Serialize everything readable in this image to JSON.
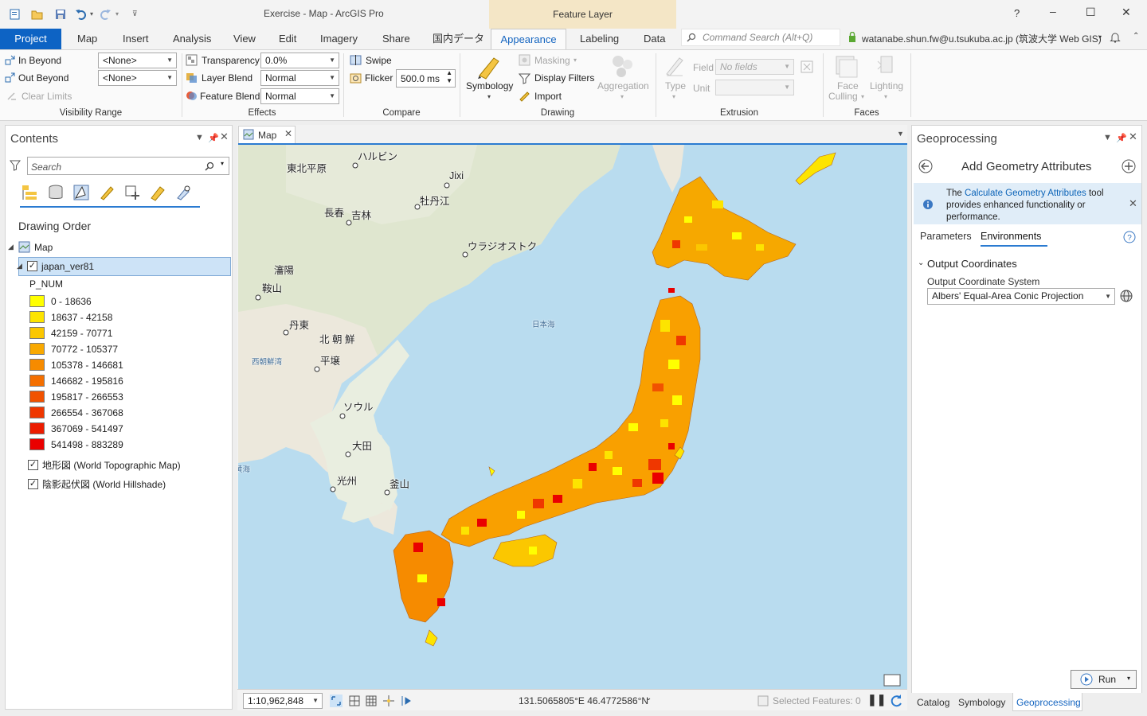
{
  "window": {
    "title": "Exercise - Map - ArcGIS Pro",
    "context_tab": "Feature Layer",
    "help": "?",
    "minimize": "–",
    "maximize": "☐",
    "close": "✕"
  },
  "tabs": [
    "Project",
    "Map",
    "Insert",
    "Analysis",
    "View",
    "Edit",
    "Imagery",
    "Share",
    "国内データ",
    "Appearance",
    "Labeling",
    "Data"
  ],
  "command_search": {
    "placeholder": "Command Search (Alt+Q)"
  },
  "user": "watanabe.shun.fw@u.tsukuba.ac.jp (筑波大学 Web GIS)",
  "ribbon": {
    "visibility_range": {
      "label": "Visibility Range",
      "in_beyond": "In Beyond",
      "out_beyond": "Out Beyond",
      "clear_limits": "Clear Limits",
      "in_value": "<None>",
      "out_value": "<None>"
    },
    "effects": {
      "label": "Effects",
      "transparency": "Transparency",
      "transparency_value": "0.0%",
      "layer_blend": "Layer Blend",
      "layer_blend_value": "Normal",
      "feature_blend": "Feature Blend",
      "feature_blend_value": "Normal"
    },
    "compare": {
      "label": "Compare",
      "swipe": "Swipe",
      "flicker": "Flicker",
      "flicker_value": "500.0",
      "flicker_unit": "ms"
    },
    "drawing": {
      "label": "Drawing",
      "symbology": "Symbology",
      "masking": "Masking",
      "display_filters": "Display Filters",
      "import": "Import",
      "aggregation": "Aggregation"
    },
    "extrusion": {
      "label": "Extrusion",
      "type": "Type",
      "field": "Field",
      "field_value": "No fields",
      "unit": "Unit"
    },
    "faces": {
      "label": "Faces",
      "face_culling_1": "Face",
      "face_culling_2": "Culling",
      "lighting": "Lighting"
    }
  },
  "contents": {
    "title": "Contents",
    "search_placeholder": "Search",
    "drawing_order": "Drawing Order",
    "map_node": "Map",
    "layer": "japan_ver81",
    "field": "P_NUM",
    "legend": [
      {
        "label": "0 - 18636",
        "color": "#ffff00"
      },
      {
        "label": "18637 - 42158",
        "color": "#fde400"
      },
      {
        "label": "42159 - 70771",
        "color": "#fbc700"
      },
      {
        "label": "70772 - 105377",
        "color": "#f9a900"
      },
      {
        "label": "105378 - 146681",
        "color": "#f68b00"
      },
      {
        "label": "146682 - 195816",
        "color": "#f46f00"
      },
      {
        "label": "195817 - 266553",
        "color": "#f15200"
      },
      {
        "label": "266554 - 367068",
        "color": "#ef3700"
      },
      {
        "label": "367069 - 541497",
        "color": "#ec1c00"
      },
      {
        "label": "541498 - 883289",
        "color": "#ea0000"
      }
    ],
    "basemaps": [
      "地形図 (World Topographic Map)",
      "陰影起伏図 (World Hillshade)"
    ]
  },
  "map": {
    "tab": "Map",
    "scale": "1:10,962,848",
    "coordinates": "131.5065805°E 46.4772586°N",
    "selected_features": "Selected Features: 0",
    "places": [
      {
        "name": "ハルビン"
      },
      {
        "name": "東北平原"
      },
      {
        "name": "Jixi"
      },
      {
        "name": "牡丹江"
      },
      {
        "name": "長春"
      },
      {
        "name": "吉林"
      },
      {
        "name": "ウラジオストク"
      },
      {
        "name": "瀋陽"
      },
      {
        "name": "鞍山"
      },
      {
        "name": "丹東"
      },
      {
        "name": "北 朝 鮮"
      },
      {
        "name": "平壌"
      },
      {
        "name": "西朝鮮湾"
      },
      {
        "name": "ソウル"
      },
      {
        "name": "大田"
      },
      {
        "name": "光州"
      },
      {
        "name": "釜山"
      },
      {
        "name": "日本海"
      },
      {
        "name": "黄海"
      }
    ]
  },
  "geoprocessing": {
    "title": "Geoprocessing",
    "tool": "Add Geometry Attributes",
    "info_prefix": "The ",
    "info_link": "Calculate Geometry Attributes",
    "info_suffix": " tool provides enhanced functionality or performance.",
    "tabs": [
      "Parameters",
      "Environments"
    ],
    "section": "Output Coordinates",
    "ocs_label": "Output Coordinate System",
    "ocs_value": "Albers' Equal-Area Conic Projection",
    "run": "Run"
  },
  "bottom_tabs": [
    "Catalog",
    "Symbology",
    "Geoprocessing"
  ]
}
